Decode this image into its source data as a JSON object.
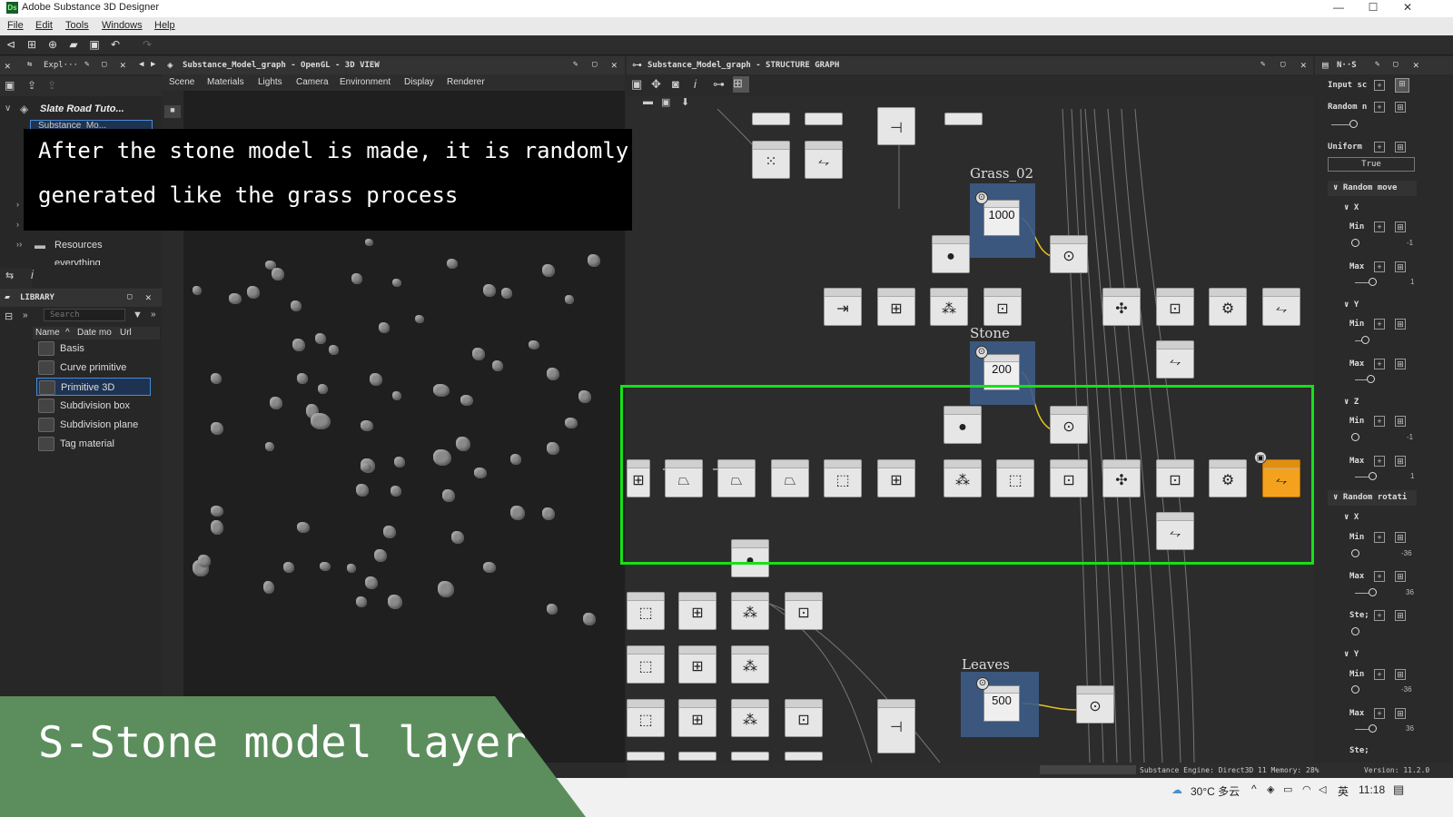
{
  "window": {
    "title": "Adobe Substance 3D Designer",
    "logo_text": "Ds",
    "minimize": "—",
    "maximize": "☐",
    "close": "✕"
  },
  "menu": [
    "File",
    "Edit",
    "Tools",
    "Windows",
    "Help"
  ],
  "explorer": {
    "tab_label": "Expl···",
    "root": "Slate Road Tuto...",
    "child": "Substance_Mo...",
    "resources": "Resources",
    "everything": "everything"
  },
  "library": {
    "title": "LIBRARY",
    "search_placeholder": "Search",
    "columns": [
      "Name",
      "Date mo",
      "Url"
    ],
    "items": [
      "Basis",
      "Curve primitive",
      "Primitive 3D",
      "Subdivision box",
      "Subdivision plane",
      "Tag material"
    ],
    "selected": "Primitive 3D"
  },
  "view3d": {
    "tab_label": "Substance_Model_graph - OpenGL - 3D VIEW",
    "menus": [
      "Scene",
      "Materials",
      "Lights",
      "Camera",
      "Environment",
      "Display",
      "Renderer"
    ]
  },
  "graph": {
    "tab_label": "Substance_Model_graph - STRUCTURE GRAPH",
    "groups": [
      {
        "label": "Grass_02",
        "value": "1000"
      },
      {
        "label": "Stone",
        "value": "200"
      },
      {
        "label": "Leaves",
        "value": "500"
      }
    ]
  },
  "properties": {
    "tab_label": "N··S",
    "input_label": "Input sc",
    "random_label": "Random n",
    "uniform_label": "Uniform",
    "uniform_value": "True",
    "random_move": "Random move",
    "random_rotation": "Random rotati",
    "axes": [
      "X",
      "Y",
      "Z"
    ],
    "min_label": "Min",
    "max_label": "Max",
    "step_label": "Ste;",
    "move_min_value": "-1",
    "move_max_value": "1",
    "rot_min_value": "-36",
    "rot_max_value": "36"
  },
  "status": {
    "engine": "Substance Engine: Direct3D 11 Memory: 28%",
    "version": "Version: 11.2.0"
  },
  "taskbar": {
    "weather": "30°C 多云",
    "ime": "英",
    "time": "11:18"
  },
  "overlay": {
    "caption_line1": "After the stone model is made, it is randomly",
    "caption_line2": "generated like the grass process",
    "banner": "S-Stone model layer"
  }
}
